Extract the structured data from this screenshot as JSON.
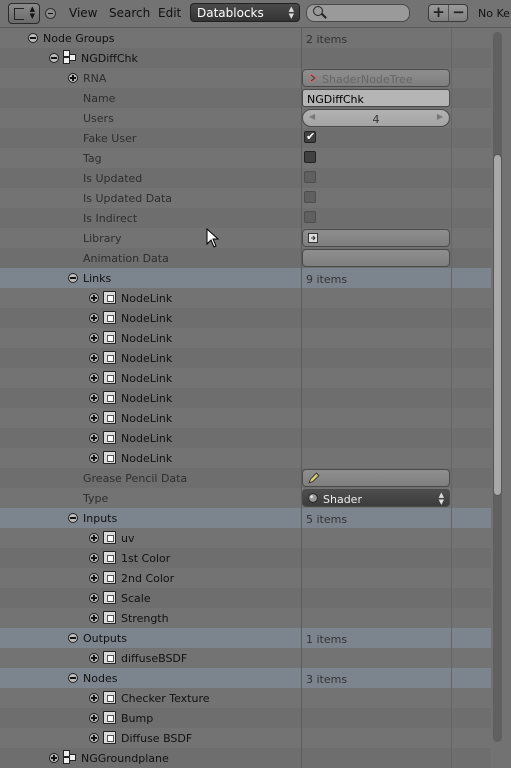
{
  "header": {
    "menu": [
      "View",
      "Search",
      "Edit"
    ],
    "display_mode": "Datablocks",
    "search_placeholder": "",
    "keyframe_status": "No Ke"
  },
  "tree": {
    "node_groups": {
      "label": "Node Groups",
      "value": "2 items"
    },
    "ngdiffchk": {
      "label": "NGDiffChk",
      "rna": {
        "label": "RNA",
        "value": "ShaderNodeTree"
      },
      "name": {
        "label": "Name",
        "value": "NGDiffChk"
      },
      "users": {
        "label": "Users",
        "value": "4"
      },
      "fake_user": {
        "label": "Fake User",
        "checked": true
      },
      "tag": {
        "label": "Tag",
        "checked": true
      },
      "is_updated": {
        "label": "Is Updated",
        "checked": false
      },
      "is_updated_data": {
        "label": "Is Updated Data",
        "checked": false
      },
      "is_indirect": {
        "label": "Is Indirect",
        "checked": false
      },
      "library": {
        "label": "Library"
      },
      "animation_data": {
        "label": "Animation Data"
      },
      "links": {
        "label": "Links",
        "value": "9 items",
        "items": [
          "NodeLink",
          "NodeLink",
          "NodeLink",
          "NodeLink",
          "NodeLink",
          "NodeLink",
          "NodeLink",
          "NodeLink",
          "NodeLink"
        ]
      },
      "grease_pencil": {
        "label": "Grease Pencil Data"
      },
      "type": {
        "label": "Type",
        "value": "Shader"
      },
      "inputs": {
        "label": "Inputs",
        "value": "5 items",
        "items": [
          "uv",
          "1st Color",
          "2nd Color",
          "Scale",
          "Strength"
        ]
      },
      "outputs": {
        "label": "Outputs",
        "value": "1 items",
        "items": [
          "diffuseBSDF"
        ]
      },
      "nodes": {
        "label": "Nodes",
        "value": "3 items",
        "items": [
          "Checker Texture",
          "Bump",
          "Diffuse BSDF"
        ]
      }
    },
    "ngground": {
      "label": "NGGroundplane"
    }
  }
}
